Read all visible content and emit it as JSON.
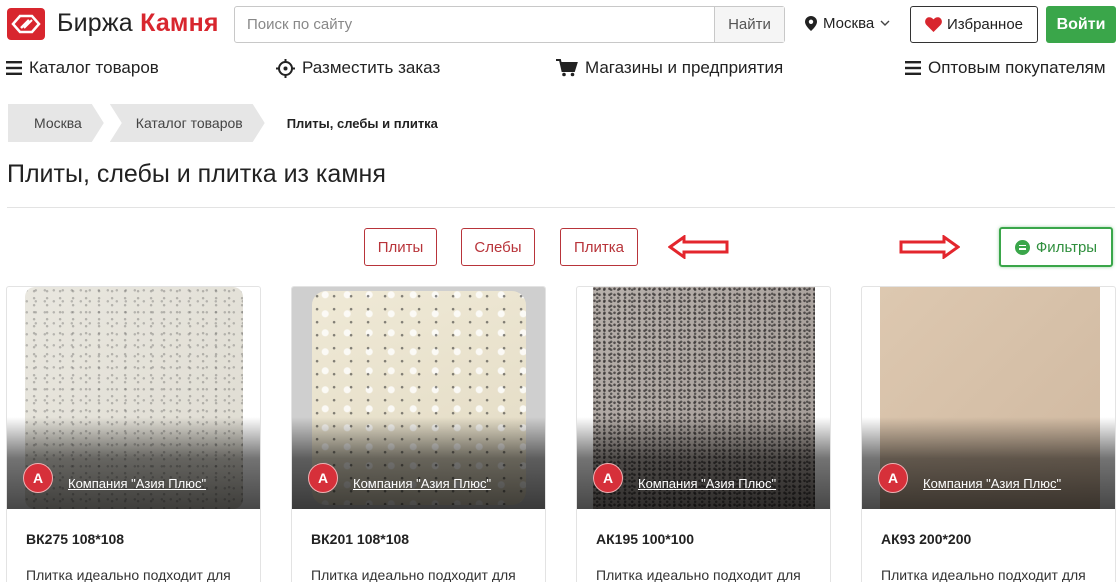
{
  "header": {
    "logo_part1": "Биржа",
    "logo_part2": "Камня",
    "search_placeholder": "Поиск по сайту",
    "search_button": "Найти",
    "city": "Москва",
    "favorites_label": "Избранное",
    "login_label": "Войти",
    "colors": {
      "brand": "#d8262e",
      "green": "#3aa64a"
    }
  },
  "nav": {
    "items": [
      {
        "label": "Каталог товаров",
        "icon": "hamburger-icon"
      },
      {
        "label": "Разместить заказ",
        "icon": "crosshair-icon"
      },
      {
        "label": "Магазины и предприятия",
        "icon": "cart-icon"
      },
      {
        "label": "Оптовым покупателям",
        "icon": "hamburger-icon"
      }
    ]
  },
  "breadcrumb": [
    "Москва",
    "Каталог товаров",
    "Плиты, слебы и плитка"
  ],
  "page_title": "Плиты, слебы и плитка из камня",
  "categories": [
    "Плиты",
    "Слебы",
    "Плитка"
  ],
  "filter_label": "Фильтры",
  "products": [
    {
      "company": "Компания \"Азия Плюс\"",
      "avatar": "А",
      "title": "ВК275 108*108",
      "desc": "Плитка идеально подходит для"
    },
    {
      "company": "Компания \"Азия Плюс\"",
      "avatar": "А",
      "title": "ВК201 108*108",
      "desc": "Плитка идеально подходит для"
    },
    {
      "company": "Компания \"Азия Плюс\"",
      "avatar": "А",
      "title": "АК195 100*100",
      "desc": "Плитка идеально подходит для"
    },
    {
      "company": "Компания \"Азия Плюс\"",
      "avatar": "А",
      "title": "АК93 200*200",
      "desc": "Плитка идеально подходит для"
    }
  ]
}
